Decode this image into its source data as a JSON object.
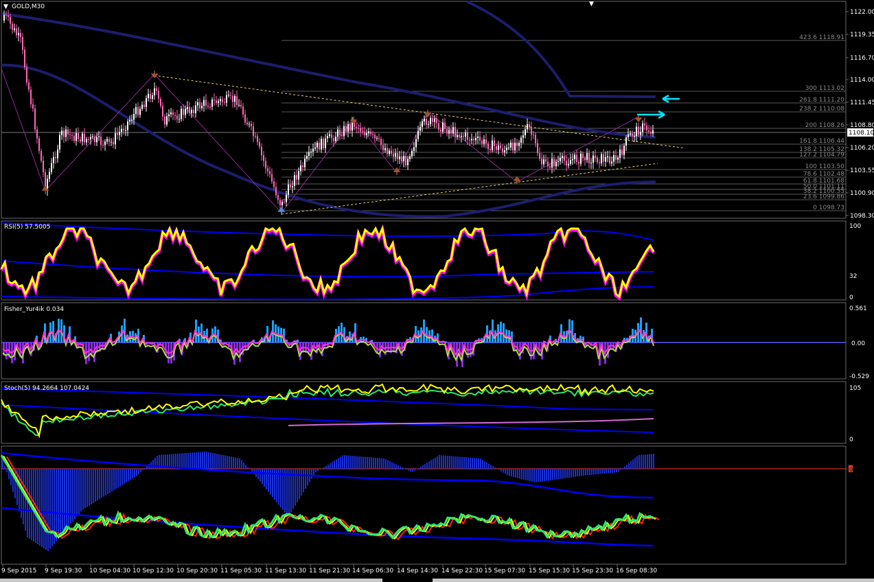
{
  "chart": {
    "symbol": "GOLD,M30",
    "current_price": "1108.10",
    "price_scale": [
      "1122.00",
      "1119.35",
      "1116.70",
      "1114.00",
      "1111.45",
      "1108.80",
      "1106.20",
      "1103.55",
      "1100.90",
      "1098.30"
    ],
    "fib_levels": [
      {
        "label": "423.6 1118.91"
      },
      {
        "label": "300 1113.02"
      },
      {
        "label": "261.8 1111.20"
      },
      {
        "label": "238.2 1110.08"
      },
      {
        "label": "200 1108.26"
      },
      {
        "label": "161.8 1106.44"
      },
      {
        "label": "138.2 1105.32"
      },
      {
        "label": "127.2 1104.79"
      },
      {
        "label": "100 1103.50"
      },
      {
        "label": "78.6 1102.48"
      },
      {
        "label": "61.8 1101.68"
      },
      {
        "label": "50.0 1101.11"
      },
      {
        "label": "38.2 1100.55"
      },
      {
        "label": "23.6 1099.86"
      },
      {
        "label": "0 1098.73"
      }
    ],
    "time_axis": [
      "9 Sep 2015",
      "9 Sep 19:30",
      "10 Sep 04:30",
      "10 Sep 12:30",
      "10 Sep 20:30",
      "11 Sep 05:30",
      "11 Sep 13:30",
      "11 Sep 21:30",
      "14 Sep 06:30",
      "14 Sep 14:30",
      "14 Sep 22:30",
      "15 Sep 07:30",
      "15 Sep 15:30",
      "15 Sep 23:30",
      "16 Sep 08:30"
    ]
  },
  "indicators": {
    "rsi": {
      "label": "RSI(5) 57.5005",
      "scale": [
        "100",
        "32",
        "0"
      ]
    },
    "fisher": {
      "label": "Fisher_Yur4ik 0.034",
      "scale": [
        "0.561",
        "0.00",
        "-0.529"
      ]
    },
    "stoch": {
      "label": "Stoch(5) 94.2664 107.0424",
      "scale": [
        "105",
        "0"
      ]
    },
    "momentum": {
      "scale_marker": "0"
    }
  },
  "colors": {
    "background": "#000000",
    "candle_up": "#ffffff",
    "candle_down": "#ff69b4",
    "ma_band": "#1d1d6e",
    "rsi_line": "#ffff00",
    "rsi_glow": "#ff00ff",
    "blue_band": "#0000ff",
    "fisher_pos": "#1e9fff",
    "fisher_neg": "#8a2be2",
    "arrow_cyan": "#00e5ff",
    "fractal_marker": "#a0522d"
  }
}
